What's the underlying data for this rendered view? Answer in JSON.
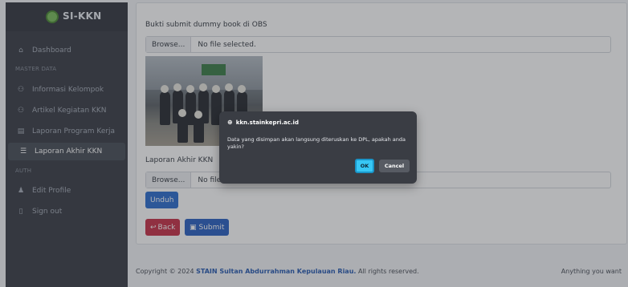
{
  "app": {
    "brand": "SI-KKN"
  },
  "sidebar": {
    "items": [
      {
        "label": "Dashboard",
        "icon": "home-icon"
      },
      {
        "label": "Informasi Kelompok",
        "icon": "users-icon"
      },
      {
        "label": "Artikel Kegiatan KKN",
        "icon": "users-icon"
      },
      {
        "label": "Laporan Program Kerja",
        "icon": "document-icon"
      },
      {
        "label": "Laporan Akhir KKN",
        "icon": "list-icon",
        "active": true
      },
      {
        "label": "Edit Profile",
        "icon": "user-edit-icon"
      },
      {
        "label": "Sign out",
        "icon": "signout-icon"
      }
    ],
    "sections": {
      "master": "MASTER DATA",
      "auth": "AUTH"
    }
  },
  "form": {
    "bukti_label": "Bukti submit dummy book di OBS",
    "bukti_browse": "Browse...",
    "bukti_file": "No file selected.",
    "laporan_label": "Laporan Akhir KKN",
    "laporan_browse": "Browse...",
    "laporan_file": "No file selected.",
    "unduh": "Unduh",
    "back": "Back",
    "submit": "Submit"
  },
  "footer": {
    "prefix": "Copyright © 2024",
    "link": "STAIN Sultan Abdurrahman Kepulauan Riau.",
    "suffix": "All rights reserved.",
    "right": "Anything you want"
  },
  "dialog": {
    "origin": "kkn.stainkepri.ac.id",
    "message": "Data yang disimpan akan langsung diteruskan ke DPL, apakah anda yakin?",
    "ok": "OK",
    "cancel": "Cancel"
  },
  "colors": {
    "sidebar": "#3c4049",
    "primary": "#2f6fd0",
    "danger": "#c8344a",
    "ok_button": "#37c7f5"
  }
}
